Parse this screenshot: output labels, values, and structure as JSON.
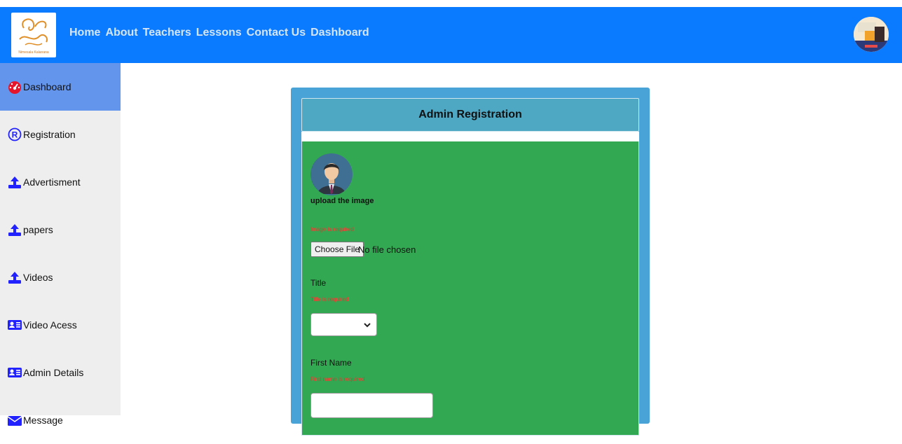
{
  "nav": {
    "logo_text": "Nimesala Kalanana",
    "links": [
      "Home",
      "About",
      "Teachers",
      "Lessons",
      "Contact Us",
      "Dashboard"
    ]
  },
  "sidebar": {
    "items": [
      {
        "label": "Dashboard",
        "icon": "speedometer-icon",
        "active": true
      },
      {
        "label": "Registration",
        "icon": "registered-icon"
      },
      {
        "label": "Advertisment",
        "icon": "upload-icon"
      },
      {
        "label": "papers",
        "icon": "upload-icon"
      },
      {
        "label": "Videos",
        "icon": "upload-icon"
      },
      {
        "label": "Video Acess",
        "icon": "id-card-icon"
      },
      {
        "label": "Admin Details",
        "icon": "id-card-icon"
      },
      {
        "label": "Message",
        "icon": "envelope-icon"
      }
    ]
  },
  "form": {
    "title": "Admin Registration",
    "upload_label": "upload the image",
    "image_error": "Image is required",
    "file_button": "Choose File",
    "file_status": "No file chosen",
    "title_label": "Title",
    "title_error": "Title is required",
    "title_selected": "",
    "first_name_label": "First Name",
    "first_name_error": "First name is required",
    "first_name_value": ""
  },
  "colors": {
    "topbar": "#0a7bff",
    "sidebar_active": "#6495ed",
    "panel": "#4aa3d6",
    "form_bg": "#33a852",
    "error": "#ff2b2b"
  }
}
